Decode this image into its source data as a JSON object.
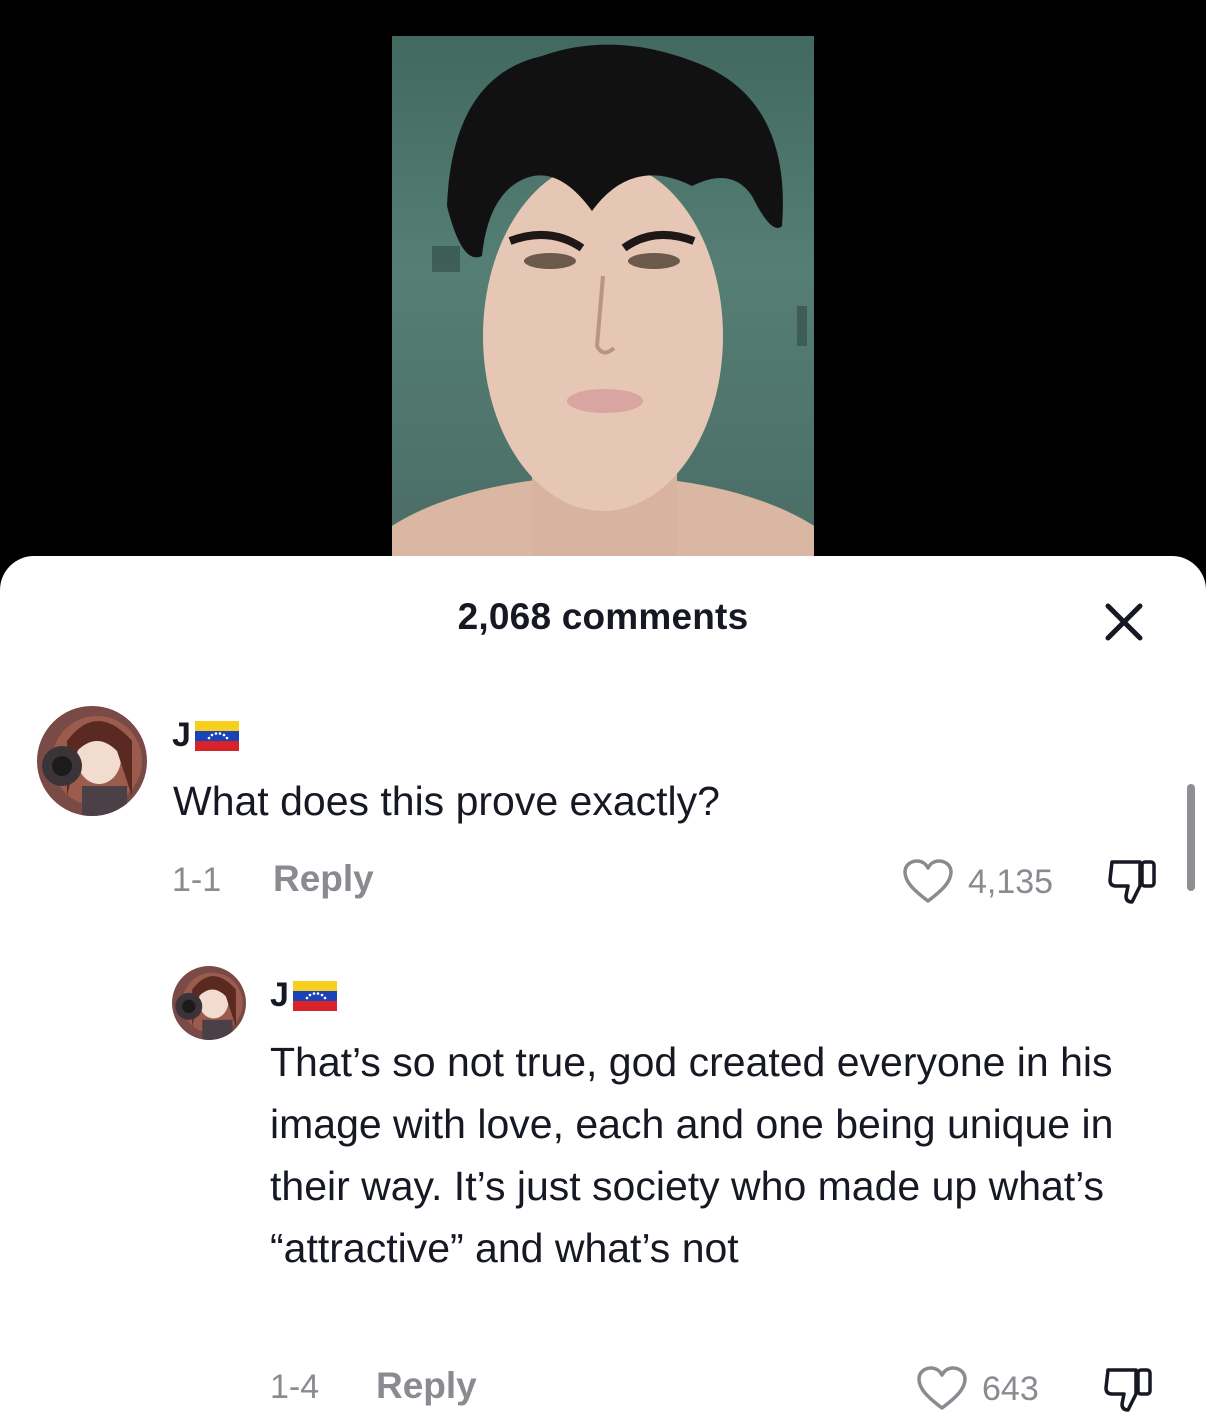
{
  "header": {
    "comments_count_label": "2,068 comments"
  },
  "comments": [
    {
      "username": "J",
      "flag_icon": "venezuela-flag-icon",
      "text": "What does this prove exactly?",
      "date": "1-1",
      "reply_label": "Reply",
      "likes": "4,135"
    }
  ],
  "replies": [
    {
      "username": "J",
      "flag_icon": "venezuela-flag-icon",
      "text": "That’s so not true, god created everyone in his image with love, each and one being unique in their way. It’s just society who made up what’s “attractive” and what’s not",
      "date": "1-4",
      "reply_label": "Reply",
      "likes": "643"
    }
  ],
  "colors": {
    "text": "#161823",
    "muted": "#8a8b91",
    "sheet": "#ffffff"
  }
}
